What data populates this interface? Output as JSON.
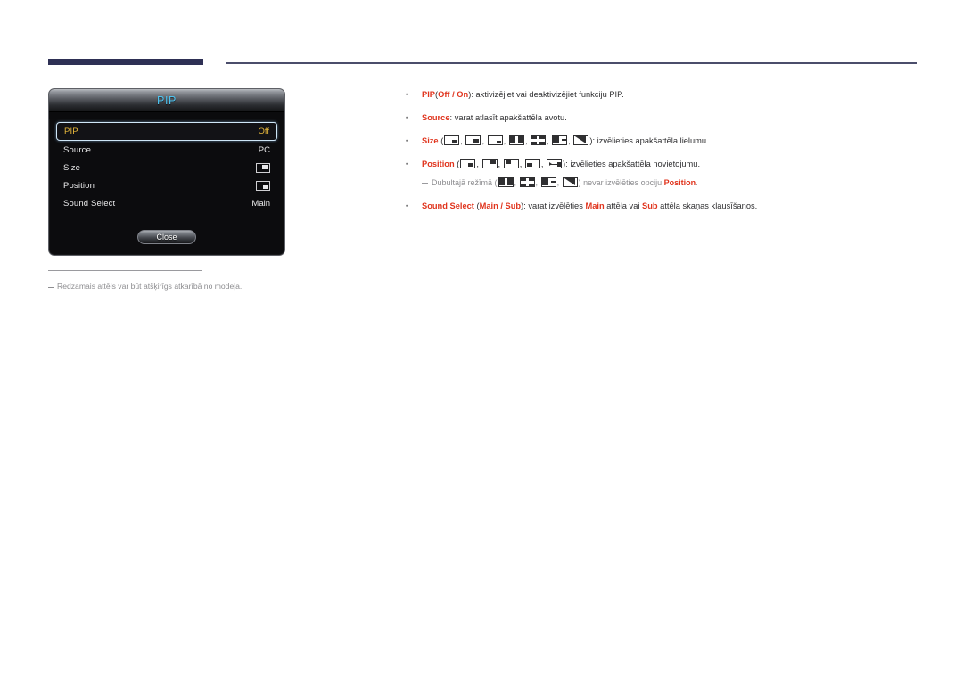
{
  "header": {
    "rule_color": "#2e3055",
    "thin_rule_color": "#4b4d6b"
  },
  "osd": {
    "title": "PIP",
    "title_color": "#4ec3f0",
    "highlight_color": "#e8b93c",
    "rows": [
      {
        "label": "PIP",
        "value": "Off",
        "value_type": "text",
        "selected": true
      },
      {
        "label": "Source",
        "value": "PC",
        "value_type": "text",
        "selected": false
      },
      {
        "label": "Size",
        "value": "",
        "value_type": "icon",
        "icon": "screen-size-small-icon",
        "selected": false
      },
      {
        "label": "Position",
        "value": "",
        "value_type": "icon",
        "icon": "screen-position-bottom-right-icon",
        "selected": false
      },
      {
        "label": "Sound Select",
        "value": "Main",
        "value_type": "text",
        "selected": false
      }
    ],
    "close_label": "Close"
  },
  "footnote": {
    "text": "Redzamais attēls var būt atšķirīgs atkarībā no modeļa."
  },
  "content": {
    "accent_color": "#e0341d",
    "bullet_glyph": "•",
    "items": {
      "pip": {
        "term": "PIP",
        "paren_open": "(",
        "opt1": "Off",
        "sep": " / ",
        "opt2": "On",
        "paren_close": ")",
        "desc": ": aktivizējiet vai deaktivizējiet funkciju PIP."
      },
      "source": {
        "term": "Source",
        "desc": ": varat atlasīt apakšattēla avotu."
      },
      "size": {
        "term": "Size",
        "paren_open": " (",
        "paren_close": ")",
        "desc": ": izvēlieties apakšattēla lielumu.",
        "icons": [
          "size-pip-small-icon",
          "size-pip-medium-icon",
          "size-pip-large-icon",
          "size-dual-vertical-icon",
          "size-dual-horizontal-icon",
          "size-dual-wide-icon",
          "size-dual-diagonal-icon"
        ]
      },
      "position": {
        "term": "Position",
        "paren_open": " (",
        "paren_close": ")",
        "desc": ": izvēlieties apakšattēla novietojumu.",
        "icons": [
          "position-bottom-right-icon",
          "position-top-right-icon",
          "position-top-left-icon",
          "position-bottom-left-icon",
          "position-custom-icon"
        ]
      },
      "dual_note": {
        "pre": "Dubultajā režīmā (",
        "mid": ") nevar izvēlēties opciju ",
        "term": "Position",
        "post": ".",
        "icons": [
          "size-dual-vertical-icon",
          "size-dual-horizontal-icon",
          "size-dual-wide-icon",
          "size-dual-diagonal-icon"
        ]
      },
      "sound_select": {
        "term": "Sound Select",
        "paren_open": " (",
        "opt1": "Main",
        "sep": " / ",
        "opt2": "Sub",
        "paren_close": ")",
        "desc_1": ": varat izvēlēties ",
        "emph_1": "Main",
        "desc_2": " attēla vai ",
        "emph_2": "Sub",
        "desc_3": " attēla skaņas klausīšanos."
      }
    }
  }
}
